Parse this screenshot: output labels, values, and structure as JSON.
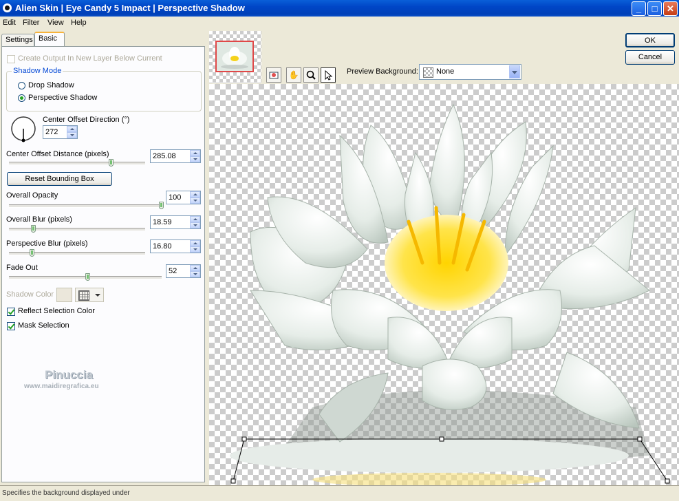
{
  "window": {
    "title": "Alien Skin  |  Eye Candy 5 Impact  |  Perspective Shadow",
    "minimize_label": "_",
    "maximize_label": "□",
    "close_label": "✕"
  },
  "menu": [
    "Edit",
    "Filter",
    "View",
    "Help"
  ],
  "tabs": [
    "Settings",
    "Basic"
  ],
  "basic": {
    "create_output_label": "Create Output In New Layer Below Current",
    "shadow_mode_title": "Shadow Mode",
    "drop_shadow_label": "Drop Shadow",
    "perspective_shadow_label": "Perspective Shadow",
    "center_offset_direction_label": "Center Offset Direction (°)",
    "center_offset_direction_value": "272",
    "center_offset_distance_label": "Center Offset Distance (pixels)",
    "center_offset_distance_value": "285.08",
    "reset_bounding_box_label": "Reset Bounding Box",
    "overall_opacity_label": "Overall Opacity",
    "overall_opacity_value": "100",
    "overall_blur_label": "Overall Blur (pixels)",
    "overall_blur_value": "18.59",
    "perspective_blur_label": "Perspective Blur (pixels)",
    "perspective_blur_value": "16.80",
    "fade_out_label": "Fade Out",
    "fade_out_value": "52",
    "shadow_color_label": "Shadow Color",
    "reflect_selection_color_label": "Reflect Selection Color",
    "mask_selection_label": "Mask Selection"
  },
  "sliders": {
    "center_offset_distance": 0.75,
    "overall_opacity": 1.0,
    "overall_blur": 0.18,
    "perspective_blur": 0.17,
    "fade_out": 0.52
  },
  "watermark": {
    "name": "Pinuccia",
    "url": "www.maidiregrafica.eu"
  },
  "preview": {
    "background_label": "Preview Background:",
    "background_value": "None"
  },
  "buttons": {
    "ok": "OK",
    "cancel": "Cancel"
  },
  "status": {
    "text": "Specifies the background displayed under"
  },
  "colors": {
    "accent": "#f7b33a",
    "titlebar": "#0046c7",
    "check": "#21a121",
    "shadow_color_swatch": "#ebe7db"
  },
  "icons": [
    "app-icon",
    "navigator-icon",
    "hand-icon",
    "zoom-icon",
    "pointer-icon",
    "dial-icon",
    "color-grid-icon",
    "chevron-down-icon"
  ]
}
